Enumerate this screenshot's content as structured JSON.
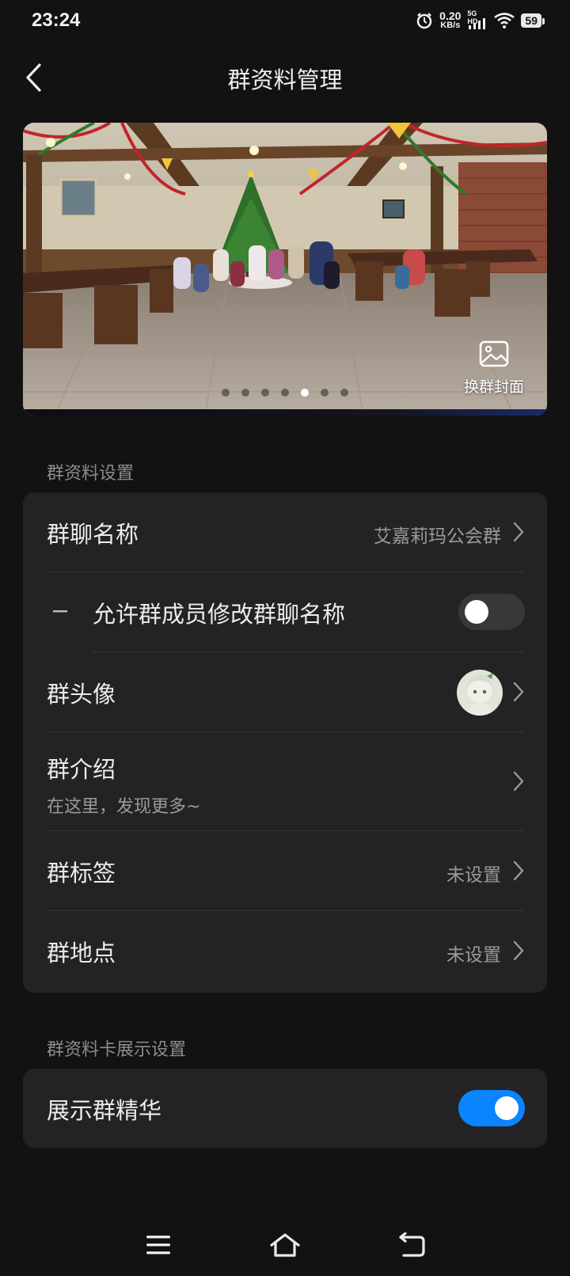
{
  "status_bar": {
    "time": "23:24",
    "net_speed_value": "0.20",
    "net_speed_unit": "KB/s",
    "signal_label": "5G HD",
    "battery": "59"
  },
  "header": {
    "title": "群资料管理"
  },
  "cover": {
    "change_cover_label": "换群封面",
    "dots_count": 7,
    "active_dot_index": 4
  },
  "section_info": {
    "label": "群资料设置",
    "rows": {
      "group_name_title": "群聊名称",
      "group_name_value": "艾嘉莉玛公会群",
      "allow_rename_title": "允许群成员修改群聊名称",
      "allow_rename_enabled": false,
      "avatar_title": "群头像",
      "intro_title": "群介绍",
      "intro_value": "在这里，发现更多~",
      "tags_title": "群标签",
      "tags_value": "未设置",
      "location_title": "群地点",
      "location_value": "未设置"
    }
  },
  "section_card": {
    "label": "群资料卡展示设置",
    "show_essence_title": "展示群精华",
    "show_essence_enabled": true
  },
  "colors": {
    "background": "#121212",
    "card": "#232325",
    "toggle_on": "#0a84ff",
    "toggle_off": "#38383a"
  }
}
